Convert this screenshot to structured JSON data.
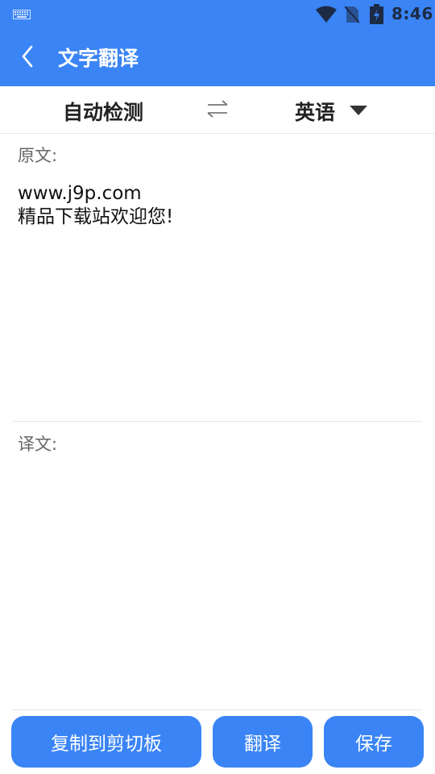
{
  "status_bar": {
    "time": "8:46",
    "icons": [
      "keyboard-icon",
      "wifi-icon",
      "no-sim-icon",
      "battery-charging-icon"
    ]
  },
  "header": {
    "title": "文字翻译",
    "back_icon": "chevron-left-icon",
    "background_color": "#3a84f5"
  },
  "language_bar": {
    "source_language": "自动检测",
    "swap_icon": "swap-arrows-icon",
    "target_language": "英语",
    "dropdown_icon": "caret-down-icon"
  },
  "source_section": {
    "label": "原文:",
    "text": "www.j9p.com\n精品下载站欢迎您!"
  },
  "result_section": {
    "label": "译文:",
    "text": ""
  },
  "actions": {
    "copy_label": "复制到剪切板",
    "translate_label": "翻译",
    "save_label": "保存",
    "button_color": "#3a84f5"
  }
}
